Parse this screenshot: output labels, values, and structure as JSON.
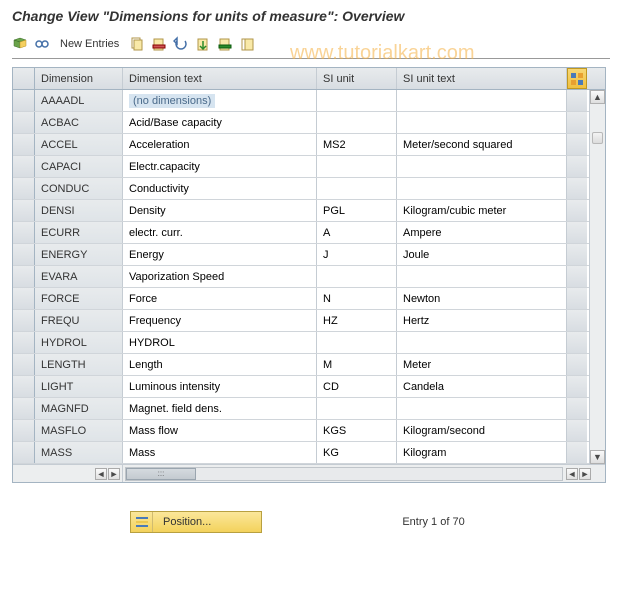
{
  "title": "Change View \"Dimensions for units of measure\": Overview",
  "watermark": "www.tutorialkart.com",
  "toolbar": {
    "new_entries_label": "New Entries"
  },
  "table": {
    "headers": {
      "dimension": "Dimension",
      "dimension_text": "Dimension text",
      "si_unit": "SI unit",
      "si_unit_text": "SI unit text"
    },
    "rows": [
      {
        "dimension": "AAAADL",
        "dimension_text": "(no dimensions)",
        "si_unit": "",
        "si_unit_text": "",
        "highlight": true
      },
      {
        "dimension": "ACBAC",
        "dimension_text": "Acid/Base capacity",
        "si_unit": "",
        "si_unit_text": ""
      },
      {
        "dimension": "ACCEL",
        "dimension_text": "Acceleration",
        "si_unit": "MS2",
        "si_unit_text": "Meter/second squared"
      },
      {
        "dimension": "CAPACI",
        "dimension_text": "Electr.capacity",
        "si_unit": "",
        "si_unit_text": ""
      },
      {
        "dimension": "CONDUC",
        "dimension_text": "Conductivity",
        "si_unit": "",
        "si_unit_text": ""
      },
      {
        "dimension": "DENSI",
        "dimension_text": "Density",
        "si_unit": "PGL",
        "si_unit_text": "Kilogram/cubic meter"
      },
      {
        "dimension": "ECURR",
        "dimension_text": "electr. curr.",
        "si_unit": "A",
        "si_unit_text": "Ampere"
      },
      {
        "dimension": "ENERGY",
        "dimension_text": "Energy",
        "si_unit": "J",
        "si_unit_text": "Joule"
      },
      {
        "dimension": "EVARA",
        "dimension_text": "Vaporization Speed",
        "si_unit": "",
        "si_unit_text": ""
      },
      {
        "dimension": "FORCE",
        "dimension_text": "Force",
        "si_unit": "N",
        "si_unit_text": "Newton"
      },
      {
        "dimension": "FREQU",
        "dimension_text": "Frequency",
        "si_unit": " HZ",
        "si_unit_text": "Hertz"
      },
      {
        "dimension": "HYDROL",
        "dimension_text": "HYDROL",
        "si_unit": "",
        "si_unit_text": ""
      },
      {
        "dimension": "LENGTH",
        "dimension_text": "Length",
        "si_unit": "M",
        "si_unit_text": "Meter"
      },
      {
        "dimension": "LIGHT",
        "dimension_text": "Luminous intensity",
        "si_unit": "CD",
        "si_unit_text": "Candela"
      },
      {
        "dimension": "MAGNFD",
        "dimension_text": "Magnet. field dens.",
        "si_unit": "",
        "si_unit_text": ""
      },
      {
        "dimension": "MASFLO",
        "dimension_text": "Mass flow",
        "si_unit": "KGS",
        "si_unit_text": "Kilogram/second"
      },
      {
        "dimension": "MASS",
        "dimension_text": "Mass",
        "si_unit": "KG",
        "si_unit_text": "Kilogram"
      }
    ]
  },
  "footer": {
    "position_label": "Position...",
    "entry_text": "Entry 1 of 70"
  }
}
